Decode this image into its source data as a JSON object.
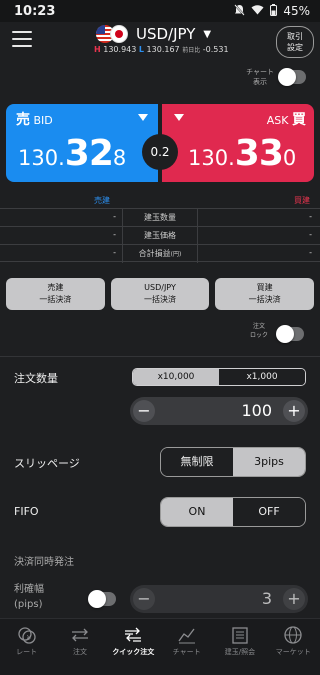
{
  "status_bar": {
    "time": "10:23",
    "battery": "45%"
  },
  "header": {
    "pair": "USD/JPY",
    "high_label": "H",
    "high": "130.943",
    "low_label": "L",
    "low": "130.167",
    "prev_label": "前日比",
    "prev_change": "-0.531",
    "settle_button": [
      "取引",
      "設定"
    ]
  },
  "chart_toggle": {
    "label": [
      "チャート",
      "表示"
    ],
    "on": false
  },
  "quote": {
    "bid_kanji": "売",
    "bid_label": "BID",
    "bid_small": "130.",
    "bid_big": "32",
    "bid_pip": "8",
    "ask_kanji": "買",
    "ask_label": "ASK",
    "ask_small": "130.",
    "ask_big": "33",
    "ask_pip": "0",
    "spread": "0.2"
  },
  "positions": {
    "sell_header": "売建",
    "buy_header": "買建",
    "rows": [
      {
        "label": "建玉数量",
        "sell": "-",
        "buy": "-"
      },
      {
        "label": "建玉価格",
        "sell": "-",
        "buy": "-"
      },
      {
        "label": "合計損益",
        "label_suffix": "(円)",
        "sell": "-",
        "buy": "-"
      }
    ]
  },
  "bulk_buttons": [
    {
      "line1": "売建",
      "line2": "一括決済"
    },
    {
      "line1": "USD/JPY",
      "line2": "一括決済"
    },
    {
      "line1": "買建",
      "line2": "一括決済"
    }
  ],
  "order_lock": {
    "label": [
      "注文",
      "ロック"
    ],
    "on": false
  },
  "order_qty": {
    "label": "注文数量",
    "units": [
      "x10,000",
      "x1,000"
    ],
    "selected_unit": "x10,000",
    "value": "100",
    "minus": "−",
    "plus": "+"
  },
  "slippage": {
    "label": "スリッページ",
    "options": [
      "無制限",
      "3pips"
    ],
    "selected": "3pips"
  },
  "fifo": {
    "label": "FIFO",
    "options": [
      "ON",
      "OFF"
    ],
    "selected": "ON"
  },
  "simul_order": {
    "label": "決済同時発注"
  },
  "take_profit": {
    "label": [
      "利確幅",
      "(pips)"
    ],
    "value": "3",
    "enabled": false
  },
  "bottom_nav": [
    {
      "icon": "rate-icon",
      "label": "レート"
    },
    {
      "icon": "order-icon",
      "label": "注文"
    },
    {
      "icon": "quick-order-icon",
      "label": "クイック注文",
      "active": true
    },
    {
      "icon": "chart-icon",
      "label": "チャート"
    },
    {
      "icon": "position-icon",
      "label": "建玉/照会"
    },
    {
      "icon": "market-icon",
      "label": "マーケット"
    }
  ],
  "colors": {
    "bid": "#1a8cf0",
    "ask": "#e0294f",
    "background": "#1e1f21"
  }
}
